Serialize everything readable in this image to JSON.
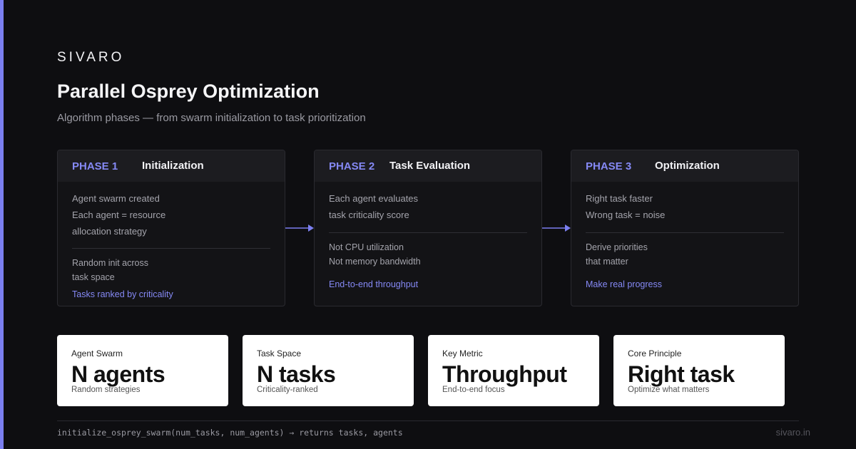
{
  "brand": "SIVARO",
  "title": "Parallel Osprey Optimization",
  "subtitle": "Algorithm phases — from swarm initialization to task prioritization",
  "phases": [
    {
      "num": "PHASE 1",
      "name": "Initialization",
      "lines": [
        "Agent swarm created",
        "Each agent = resource",
        "allocation strategy"
      ],
      "details": [
        "Random init across",
        "task space"
      ],
      "accent": "Tasks ranked by criticality"
    },
    {
      "num": "PHASE 2",
      "name": "Task Evaluation",
      "lines": [
        "Each agent evaluates",
        "task criticality score"
      ],
      "details": [
        "Not CPU utilization",
        "Not memory bandwidth"
      ],
      "accent": "End-to-end throughput"
    },
    {
      "num": "PHASE 3",
      "name": "Optimization",
      "lines": [
        "Right task faster",
        "Wrong task = noise"
      ],
      "details": [
        "Derive priorities",
        "that matter"
      ],
      "accent": "Make real progress"
    }
  ],
  "stats": [
    {
      "label": "Agent Swarm",
      "value": "N agents",
      "sub": "Random strategies"
    },
    {
      "label": "Task Space",
      "value": "N tasks",
      "sub": "Criticality-ranked"
    },
    {
      "label": "Key Metric",
      "value": "Throughput",
      "sub": "End-to-end focus"
    },
    {
      "label": "Core Principle",
      "value": "Right task",
      "sub": "Optimize what matters"
    }
  ],
  "footer": {
    "code": "initialize_osprey_swarm(num_tasks, num_agents) → returns tasks, agents",
    "site": "sivaro.in"
  },
  "colors": {
    "accent": "#7b7ff0",
    "background": "#0e0e11",
    "card": "#131316"
  }
}
